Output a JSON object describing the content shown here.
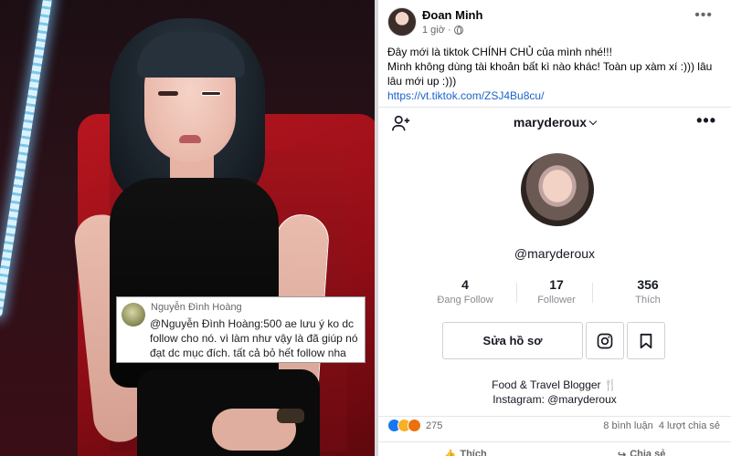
{
  "comment_overlay": {
    "author": "Nguyễn Đình Hoàng",
    "text": "@Nguyễn Đình Hoàng:500 ae lưu ý ko dc follow cho nó. vì làm như vậy là đã giúp nó đạt dc mục đích. tất cả bỏ hết follow nha"
  },
  "post": {
    "author": "Đoan Minh",
    "time": "1 giờ",
    "separator": "·",
    "text_line1": "Đây mới là tiktok CHÍNH CHỦ của mình nhé!!!",
    "text_line2": "Mình không dùng tài khoản bất kì nào khác! Toàn up xàm xí :))) lâu lâu mới up :)))",
    "link": "https://vt.tiktok.com/ZSJ4Bu8cu/"
  },
  "tiktok": {
    "username": "maryderoux",
    "handle": "@maryderoux",
    "stats": [
      {
        "value": "4",
        "label": "Đang Follow"
      },
      {
        "value": "17",
        "label": "Follower"
      },
      {
        "value": "356",
        "label": "Thích"
      }
    ],
    "edit_profile": "Sửa hồ sơ",
    "bio_line1": "Food & Travel Blogger 🍴",
    "bio_line2": "Instagram: @maryderoux"
  },
  "engagement": {
    "reaction_count": "275",
    "comments": "8 bình luận",
    "shares": "4 lượt chia sẻ",
    "like_label": "Thích",
    "share_label": "Chia sẻ"
  },
  "icons": [
    "globe-icon",
    "more-icon",
    "add-user-icon",
    "chevron-down-icon",
    "instagram-icon",
    "bookmark-icon",
    "like-icon",
    "share-icon"
  ],
  "colors": {
    "link": "#1c63c9",
    "like": "#1877f2",
    "chair": "#b8161f"
  }
}
